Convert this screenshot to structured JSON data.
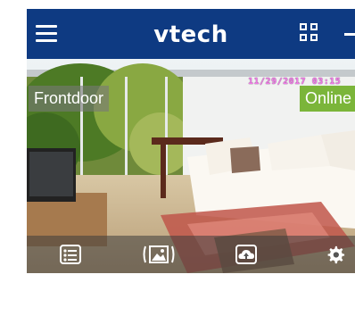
{
  "header": {
    "title": "vtech",
    "menu_icon": "hamburger-menu-icon",
    "grid_icon": "grid-view-icon",
    "add_icon": "add-icon"
  },
  "camera": {
    "name": "Frontdoor",
    "status": "Online",
    "timestamp": "11/29/2017 03:15"
  },
  "controls": [
    "event-list-icon",
    "snapshot-icon",
    "cloud-icon",
    "gear-icon"
  ],
  "colors": {
    "header_bg": "#0e3a82",
    "status_online": "#7bb53a",
    "timestamp": "#f07ae6"
  }
}
